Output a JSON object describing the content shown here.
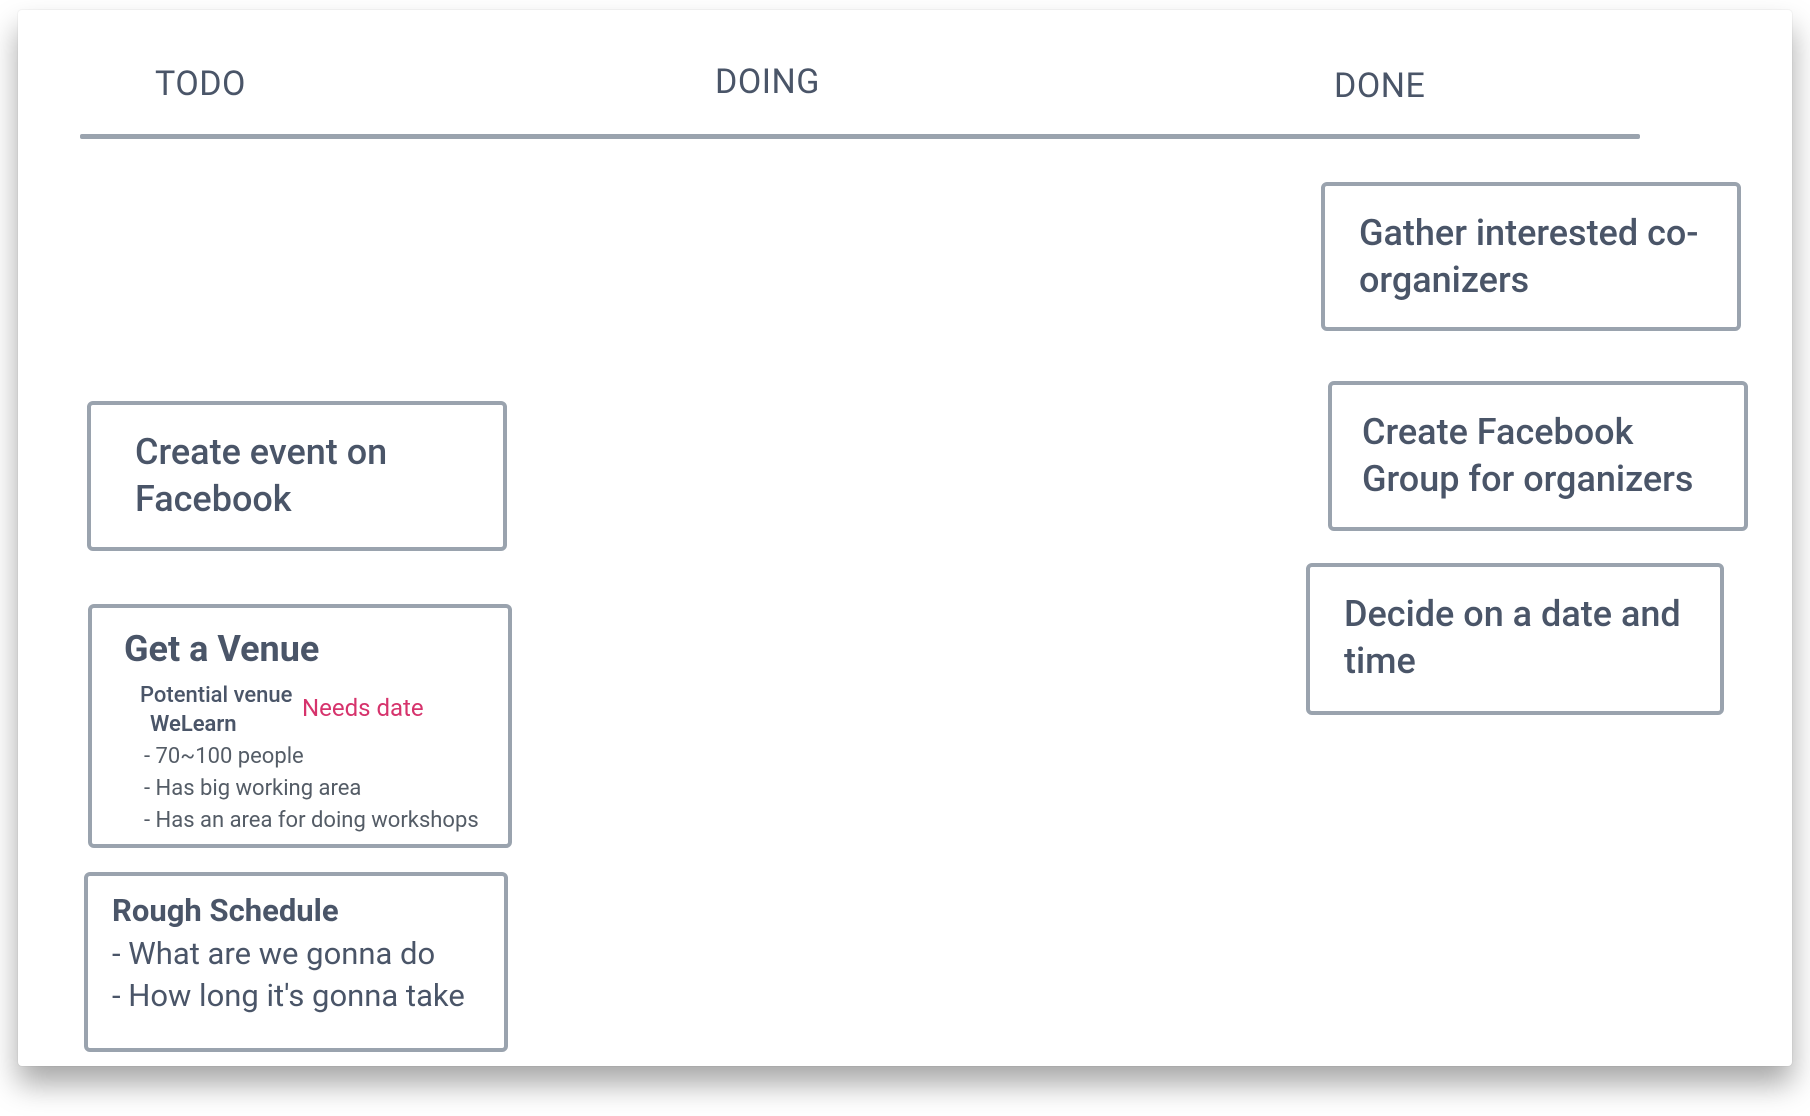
{
  "columns": {
    "todo": {
      "label": "TODO"
    },
    "doing": {
      "label": "DOING"
    },
    "done": {
      "label": "DONE"
    }
  },
  "todo": {
    "card_event": {
      "title": "Create event on Facebook"
    },
    "card_venue": {
      "title": "Get a Venue",
      "subhead": "Potential venue",
      "venue_name": "WeLearn",
      "tag": "Needs date",
      "bullets": {
        "b1": "- 70~100 people",
        "b2": "- Has big working area",
        "b3": "- Has an area for doing workshops"
      }
    },
    "card_sched": {
      "title": "Rough Schedule",
      "line1": "- What are we gonna do",
      "line2": "- How long it's gonna take"
    }
  },
  "done": {
    "card_gather": {
      "title": "Gather interested co-organizers"
    },
    "card_fbgroup": {
      "title": "Create Facebook Group for organizers"
    },
    "card_date": {
      "title": "Decide on a date and time"
    }
  }
}
